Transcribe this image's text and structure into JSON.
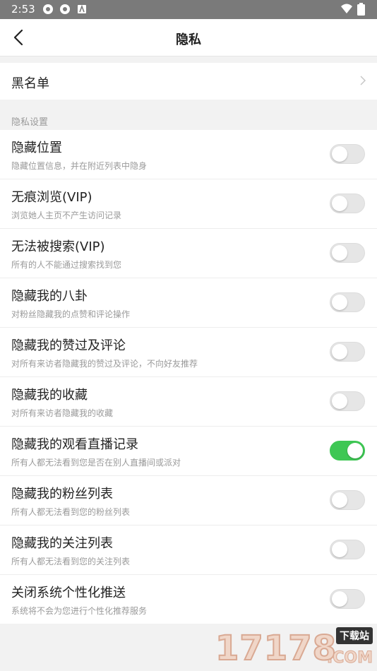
{
  "status_bar": {
    "time": "2:53",
    "icons": [
      "app-icon",
      "app-icon",
      "notification-icon"
    ],
    "right_icons": [
      "wifi-icon",
      "battery-icon"
    ]
  },
  "header": {
    "title": "隐私",
    "back_icon": "chevron-left-icon"
  },
  "blacklist": {
    "label": "黑名单",
    "icon": "chevron-right-icon"
  },
  "section": {
    "label": "隐私设置"
  },
  "settings": [
    {
      "title": "隐藏位置",
      "subtitle": "隐藏位置信息，并在附近列表中隐身",
      "enabled": false
    },
    {
      "title": "无痕浏览(VIP)",
      "subtitle": "浏览她人主页不产生访问记录",
      "enabled": false
    },
    {
      "title": "无法被搜索(VIP)",
      "subtitle": "所有的人不能通过搜索找到您",
      "enabled": false
    },
    {
      "title": "隐藏我的八卦",
      "subtitle": "对粉丝隐藏我的点赞和评论操作",
      "enabled": false
    },
    {
      "title": "隐藏我的赞过及评论",
      "subtitle": "对所有来访者隐藏我的赞过及评论，不向好友推荐",
      "enabled": false
    },
    {
      "title": "隐藏我的收藏",
      "subtitle": "对所有来访者隐藏我的收藏",
      "enabled": false
    },
    {
      "title": "隐藏我的观看直播记录",
      "subtitle": "所有人都无法看到您是否在别人直播间或派对",
      "enabled": true
    },
    {
      "title": "隐藏我的粉丝列表",
      "subtitle": "所有人都无法看到您的粉丝列表",
      "enabled": false
    },
    {
      "title": "隐藏我的关注列表",
      "subtitle": "所有人都无法看到您的关注列表",
      "enabled": false
    },
    {
      "title": "关闭系统个性化推送",
      "subtitle": "系统将不会为您进行个性化推荐服务",
      "enabled": false
    }
  ],
  "colors": {
    "toggle_on": "#3ec754",
    "toggle_off": "#e6e6e6",
    "background": "#f2f2f2"
  },
  "watermark": {
    "number": "17178",
    "tag": "下载站",
    "domain": ".COM"
  }
}
